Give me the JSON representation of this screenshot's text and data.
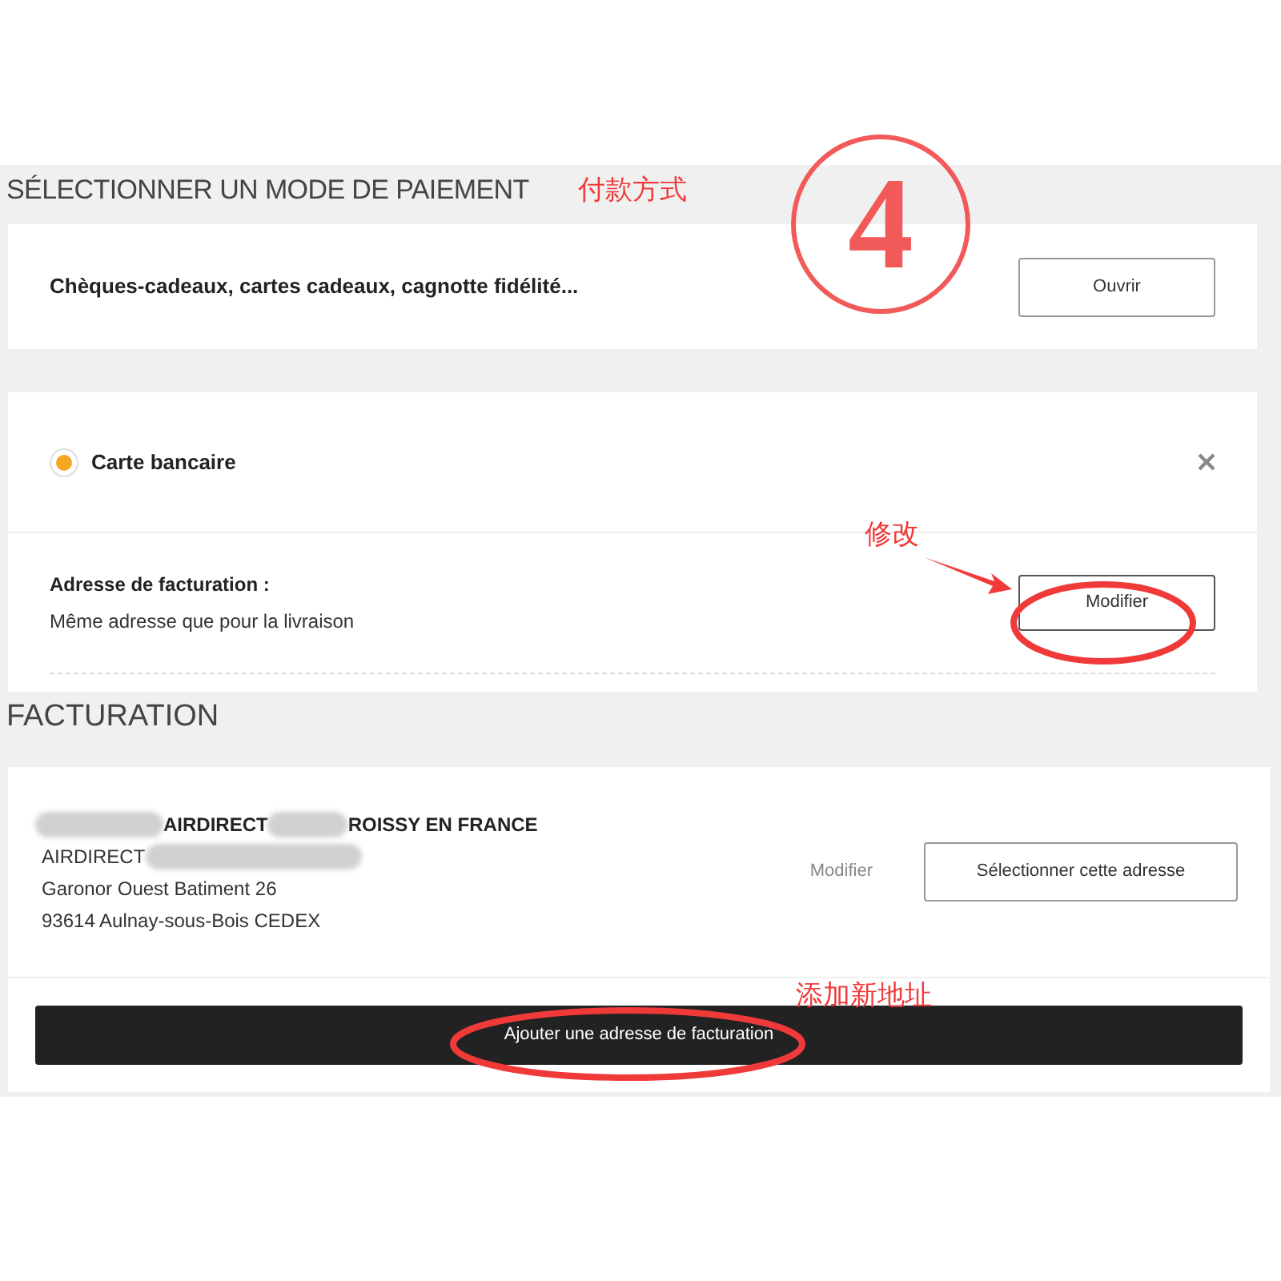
{
  "payment": {
    "heading": "SÉLECTIONNER UN MODE DE PAIEMENT",
    "gift_row": {
      "label": "Chèques-cadeaux, cartes cadeaux, cagnotte fidélité...",
      "button": "Ouvrir"
    },
    "method": {
      "label": "Carte bancaire",
      "selected": true
    },
    "billing": {
      "label": "Adresse de facturation :",
      "value": "Même adresse que pour la livraison",
      "button": "Modifier"
    }
  },
  "facturation": {
    "heading": "FACTURATION",
    "address": {
      "lines": [
        [
          {
            "kind": "redacted"
          },
          {
            "kind": "text",
            "text": "AIRDIRECT"
          },
          {
            "kind": "redacted"
          },
          {
            "kind": "text",
            "text": "ROISSY EN FRANCE"
          }
        ],
        [
          {
            "kind": "text",
            "text": "AIRDIRECT"
          },
          {
            "kind": "redacted"
          }
        ],
        [
          {
            "kind": "text",
            "text": "Garonor Ouest Batiment 26"
          }
        ],
        [
          {
            "kind": "text",
            "text": "93614 Aulnay-sous-Bois CEDEX"
          }
        ]
      ],
      "edit_link": "Modifier",
      "select_button": "Sélectionner cette adresse"
    },
    "add_button": "Ajouter une adresse de facturation"
  },
  "annotations": [
    {
      "kind": "label",
      "text": "付款方式"
    },
    {
      "kind": "step",
      "text": "4"
    },
    {
      "kind": "label",
      "text": "修改"
    },
    {
      "kind": "label",
      "text": "添加新地址"
    }
  ]
}
